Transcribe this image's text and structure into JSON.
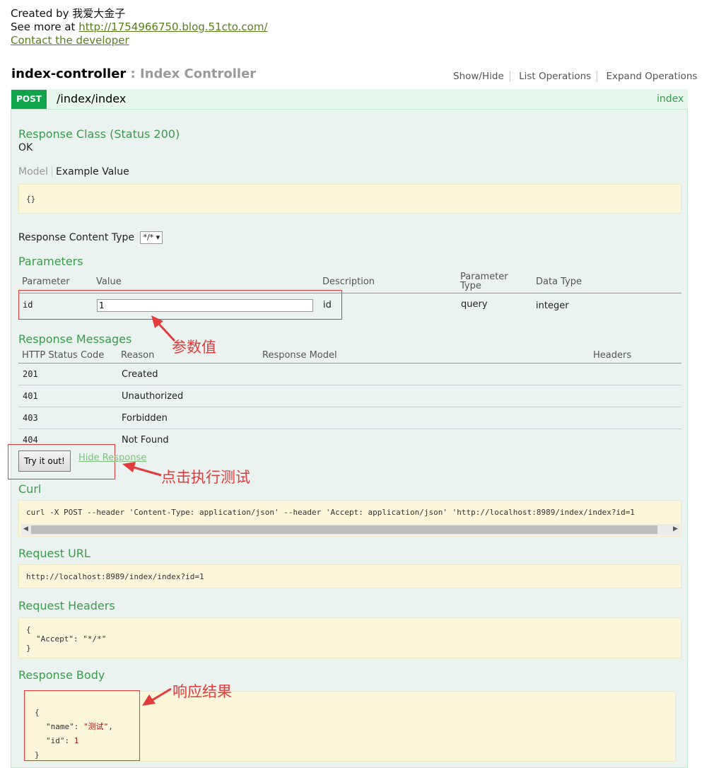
{
  "header": {
    "created_by": "Created by 我爱大金子",
    "see_more_prefix": "See more at ",
    "see_more_url": "http://1754966750.blog.51cto.com/",
    "contact": "Contact the developer"
  },
  "controller": {
    "name": "index-controller",
    "separator": " : ",
    "description": "Index Controller",
    "links": [
      "Show/Hide",
      "List Operations",
      "Expand Operations"
    ]
  },
  "operation": {
    "method": "POST",
    "path": "/index/index",
    "summary": "index"
  },
  "response_class": {
    "title": "Response Class (Status 200)",
    "status_text": "OK",
    "tab_model": "Model",
    "tab_example": "Example Value",
    "example": "{}"
  },
  "content_type": {
    "label": "Response Content Type",
    "selected": "*/* ▾"
  },
  "parameters": {
    "title": "Parameters",
    "headers": {
      "parameter": "Parameter",
      "value": "Value",
      "description": "Description",
      "parameter_type_1": "Parameter",
      "parameter_type_2": "Type",
      "data_type": "Data Type"
    },
    "row": {
      "name": "id",
      "value": "1",
      "description": "id",
      "param_type": "query",
      "data_type": "integer"
    }
  },
  "response_messages": {
    "title": "Response Messages",
    "headers": {
      "code": "HTTP Status Code",
      "reason": "Reason",
      "model": "Response Model",
      "headers": "Headers"
    },
    "rows": [
      {
        "code": "201",
        "reason": "Created"
      },
      {
        "code": "401",
        "reason": "Unauthorized"
      },
      {
        "code": "403",
        "reason": "Forbidden"
      },
      {
        "code": "404",
        "reason": "Not Found"
      }
    ]
  },
  "actions": {
    "try_label": "Try it out!",
    "hide_label": "Hide Response"
  },
  "curl": {
    "title": "Curl",
    "command": "curl -X POST --header 'Content-Type: application/json' --header 'Accept: application/json' 'http://localhost:8989/index/index?id=1"
  },
  "request_url": {
    "title": "Request URL",
    "value": "http://localhost:8989/index/index?id=1"
  },
  "request_headers": {
    "title": "Request Headers",
    "open": "{",
    "line": "\"Accept\": \"*/*\"",
    "close": "}"
  },
  "response_body": {
    "title": "Response Body",
    "open": "{",
    "name_key": "\"name\"",
    "name_value": "\"测试\"",
    "id_key": "\"id\"",
    "id_value": "1",
    "close": "}"
  },
  "annotations": {
    "param_value": "参数值",
    "click_execute": "点击执行测试",
    "response_result": "响应结果"
  },
  "colors": {
    "accent_green": "#3b9a4c",
    "post_badge": "#10a54a",
    "annotation_red": "#e23b3b",
    "code_background": "#fcf6db"
  }
}
